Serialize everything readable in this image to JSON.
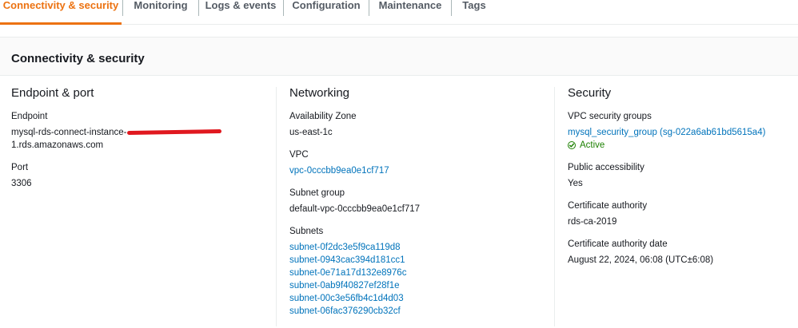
{
  "tabs": [
    {
      "label": "Connectivity & security",
      "active": true
    },
    {
      "label": "Monitoring",
      "active": false
    },
    {
      "label": "Logs & events",
      "active": false
    },
    {
      "label": "Configuration",
      "active": false
    },
    {
      "label": "Maintenance",
      "active": false
    },
    {
      "label": "Tags",
      "active": false
    }
  ],
  "panel": {
    "title": "Connectivity & security"
  },
  "endpoint": {
    "heading": "Endpoint & port",
    "endpoint_label": "Endpoint",
    "endpoint_value_line1": "mysql-rds-connect-instance-",
    "endpoint_value_line2": "1.rds.amazonaws.com",
    "port_label": "Port",
    "port_value": "3306"
  },
  "networking": {
    "heading": "Networking",
    "az_label": "Availability Zone",
    "az_value": "us-east-1c",
    "vpc_label": "VPC",
    "vpc_value": "vpc-0cccbb9ea0e1cf717",
    "subnet_group_label": "Subnet group",
    "subnet_group_value": "default-vpc-0cccbb9ea0e1cf717",
    "subnets_label": "Subnets",
    "subnets": [
      "subnet-0f2dc3e5f9ca119d8",
      "subnet-0943cac394d181cc1",
      "subnet-0e71a17d132e8976c",
      "subnet-0ab9f40827ef28f1e",
      "subnet-00c3e56fb4c1d4d03",
      "subnet-06fac376290cb32cf"
    ]
  },
  "security": {
    "heading": "Security",
    "vpc_sg_label": "VPC security groups",
    "vpc_sg_value": "mysql_security_group (sg-022a6ab61bd5615a4)",
    "vpc_sg_status": "Active",
    "public_label": "Public accessibility",
    "public_value": "Yes",
    "ca_label": "Certificate authority",
    "ca_value": "rds-ca-2019",
    "ca_date_label": "Certificate authority date",
    "ca_date_value": "August 22, 2024, 06:08 (UTC±6:08)"
  },
  "colors": {
    "accent": "#ec7211",
    "link": "#0073bb",
    "success": "#1d8102",
    "redaction": "#e0181f"
  }
}
